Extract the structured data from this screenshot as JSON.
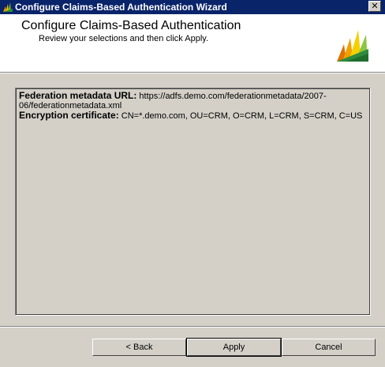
{
  "window": {
    "title": "Configure Claims-Based Authentication Wizard",
    "close_glyph": "✕"
  },
  "header": {
    "title": "Configure Claims-Based Authentication",
    "subtitle": "Review your selections and then click Apply."
  },
  "summary": {
    "rows": [
      {
        "label": "Federation metadata URL:",
        "value": "https://adfs.demo.com/federationmetadata/2007-06/federationmetadata.xml"
      },
      {
        "label": "Encryption certificate:",
        "value": "CN=*.demo.com, OU=CRM, O=CRM, L=CRM, S=CRM, C=US"
      }
    ]
  },
  "buttons": {
    "back": "< Back",
    "apply": "Apply",
    "cancel": "Cancel"
  },
  "colors": {
    "titlebar": "#0a246a",
    "face": "#d4d0c8",
    "header_bg": "#ffffff"
  },
  "icons": {
    "app": "dynamics-crm-logo-icon",
    "header_logo": "dynamics-crm-logo-icon",
    "close": "close-icon"
  }
}
